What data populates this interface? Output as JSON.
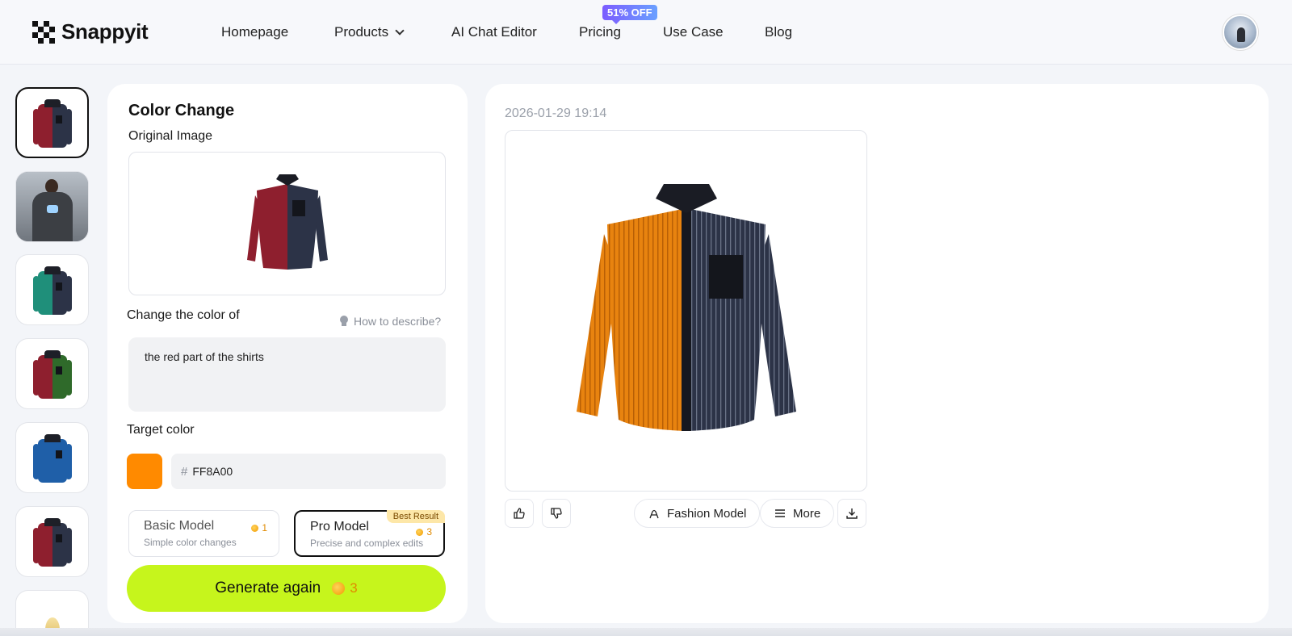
{
  "brand": {
    "name": "Snappyit"
  },
  "nav": {
    "items": [
      "Homepage",
      "Products",
      "AI Chat Editor",
      "Pricing",
      "Use Case",
      "Blog"
    ],
    "pricing_badge": "51% OFF"
  },
  "thumbnails": [
    {
      "name": "shirt-red-navy",
      "left": "#8e1f2e",
      "right": "#2c3347"
    },
    {
      "name": "person-hoodie"
    },
    {
      "name": "shirt-teal-navy",
      "left": "#1f8f7a",
      "right": "#2c3347"
    },
    {
      "name": "shirt-red-green",
      "left": "#8e1f2e",
      "right": "#2f6a2a"
    },
    {
      "name": "shirt-blue",
      "left": "#1f5fa8",
      "right": "#1f5fa8"
    },
    {
      "name": "shirt-red-navy-2",
      "left": "#8e1f2e",
      "right": "#2c3347"
    },
    {
      "name": "dress-gold"
    }
  ],
  "editor": {
    "title": "Color Change",
    "original_label": "Original Image",
    "change_label": "Change the color of",
    "how_to": "How to describe?",
    "prompt_value": "the red part of the shirts",
    "target_label": "Target color",
    "hex_symbol": "#",
    "hex_value": "FF8A00",
    "target_color": "#FF8A00",
    "models": {
      "basic": {
        "name": "Basic Model",
        "desc": "Simple color changes",
        "cost": "1"
      },
      "pro": {
        "name": "Pro Model",
        "desc": "Precise and complex edits",
        "cost": "3",
        "badge": "Best Result"
      }
    },
    "generate_label": "Generate again",
    "generate_cost": "3"
  },
  "result": {
    "timestamp": "2026-01-29 19:14",
    "fashion_model_label": "Fashion Model",
    "more_label": "More"
  },
  "colors": {
    "accent": "#c6f51c",
    "original_left": "#8e1f2e",
    "original_right": "#2c3347",
    "result_left": "#FF8A00",
    "result_right": "#2c3347"
  }
}
